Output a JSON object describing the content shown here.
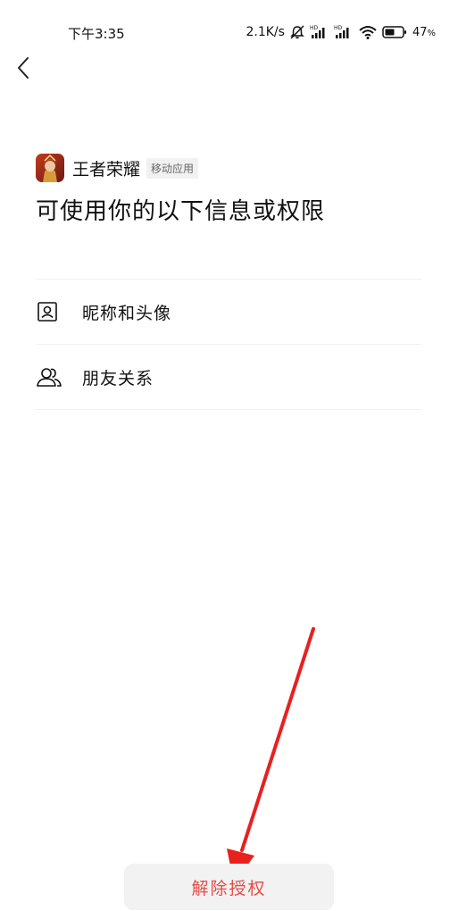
{
  "status_bar": {
    "time": "下午3:35",
    "network_speed": "2.1K/s",
    "battery_percent": "47",
    "battery_unit": "%",
    "icons": [
      "alarm-off-icon",
      "hd-signal-icon",
      "hd-signal-icon",
      "wifi-icon",
      "battery-icon"
    ]
  },
  "nav": {
    "back_icon": "back-chevron-icon"
  },
  "app": {
    "name": "王者荣耀",
    "tag": "移动应用"
  },
  "page": {
    "title": "可使用你的以下信息或权限"
  },
  "permissions": [
    {
      "icon": "profile-card-icon",
      "label": "昵称和头像"
    },
    {
      "icon": "friends-icon",
      "label": "朋友关系"
    }
  ],
  "actions": {
    "revoke_label": "解除授权"
  },
  "colors": {
    "revoke_text": "#e64a45",
    "revoke_bg": "#f2f2f2",
    "annotation_arrow": "#e8201e",
    "divider": "#f0f0f0"
  }
}
